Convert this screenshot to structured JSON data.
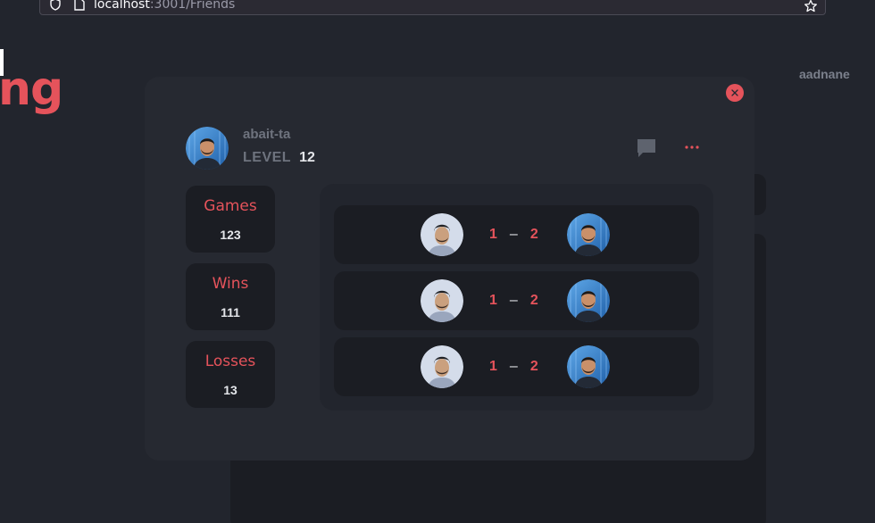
{
  "browser": {
    "url_host": "localhost",
    "url_path": ":3001/Friends"
  },
  "background": {
    "logo_text": "ng",
    "username": "aadnane"
  },
  "modal": {
    "profile": {
      "username": "abait-ta",
      "level_label": "LEVEL",
      "level_value": "12"
    },
    "stats": [
      {
        "label": "Games",
        "value": "123"
      },
      {
        "label": "Wins",
        "value": "111"
      },
      {
        "label": "Losses",
        "value": "13"
      }
    ],
    "matches": [
      {
        "score_a": "1",
        "separator": "–",
        "score_b": "2"
      },
      {
        "score_a": "1",
        "separator": "–",
        "score_b": "2"
      },
      {
        "score_a": "1",
        "separator": "–",
        "score_b": "2"
      }
    ]
  },
  "icons": {
    "close": "close-icon",
    "chat": "chat-icon",
    "more": "more-icon"
  },
  "colors": {
    "accent": "#e5535b",
    "background": "#22252d",
    "card": "#262931",
    "panel": "#1b1d23"
  }
}
